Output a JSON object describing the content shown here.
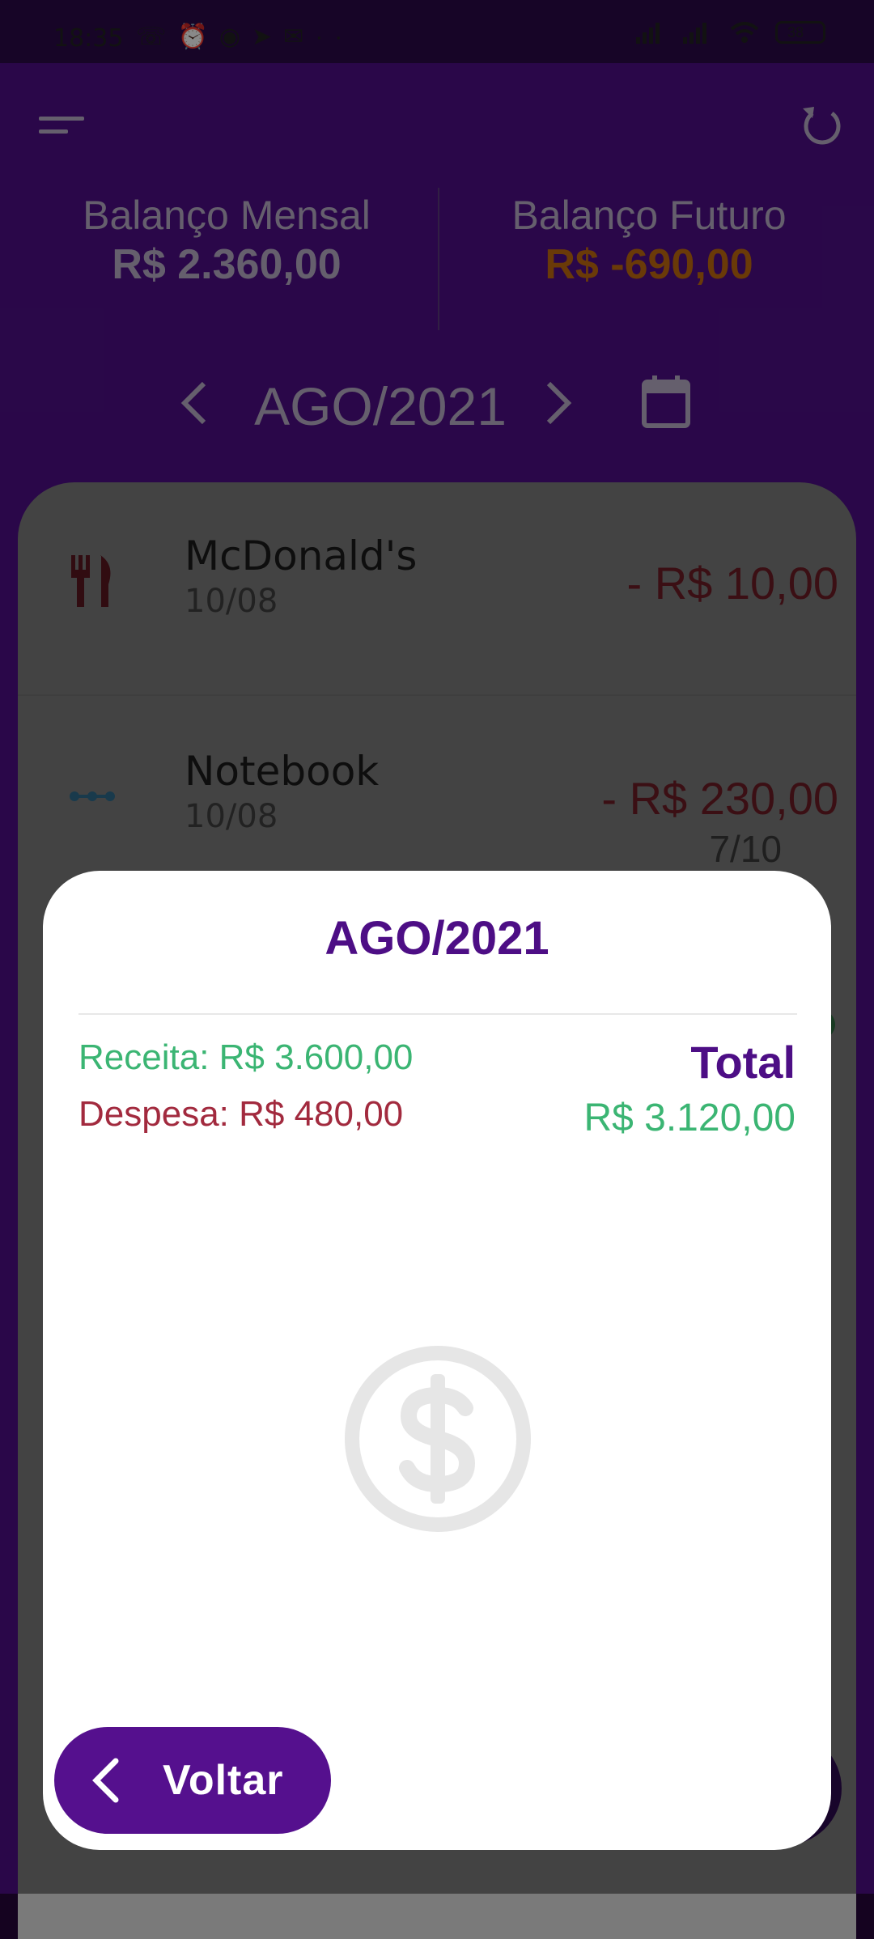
{
  "status_bar": {
    "time": "18:35",
    "battery": "38"
  },
  "header": {
    "monthly_balance": {
      "title": "Balanço Mensal",
      "value": "R$ 2.360,00"
    },
    "future_balance": {
      "title": "Balanço Futuro",
      "value": "R$ -690,00"
    },
    "month": "AGO/2021"
  },
  "transactions": [
    {
      "name": "McDonald's",
      "date": "10/08",
      "amount": "- R$ 10,00",
      "installment": "",
      "icon": "fork-knife-icon"
    },
    {
      "name": "Notebook",
      "date": "10/08",
      "amount": "- R$ 230,00",
      "installment": "7/10",
      "icon": "dots-icon"
    }
  ],
  "modal": {
    "title": "AGO/2021",
    "income": "Receita: R$ 3.600,00",
    "expense": "Despesa: R$ 480,00",
    "total_label": "Total",
    "total_value": "R$ 3.120,00",
    "back_label": "Voltar"
  },
  "colors": {
    "primary": "#4d0e85",
    "income": "#3bb573",
    "expense": "#a22a3e",
    "future_negative": "#c26a10"
  }
}
